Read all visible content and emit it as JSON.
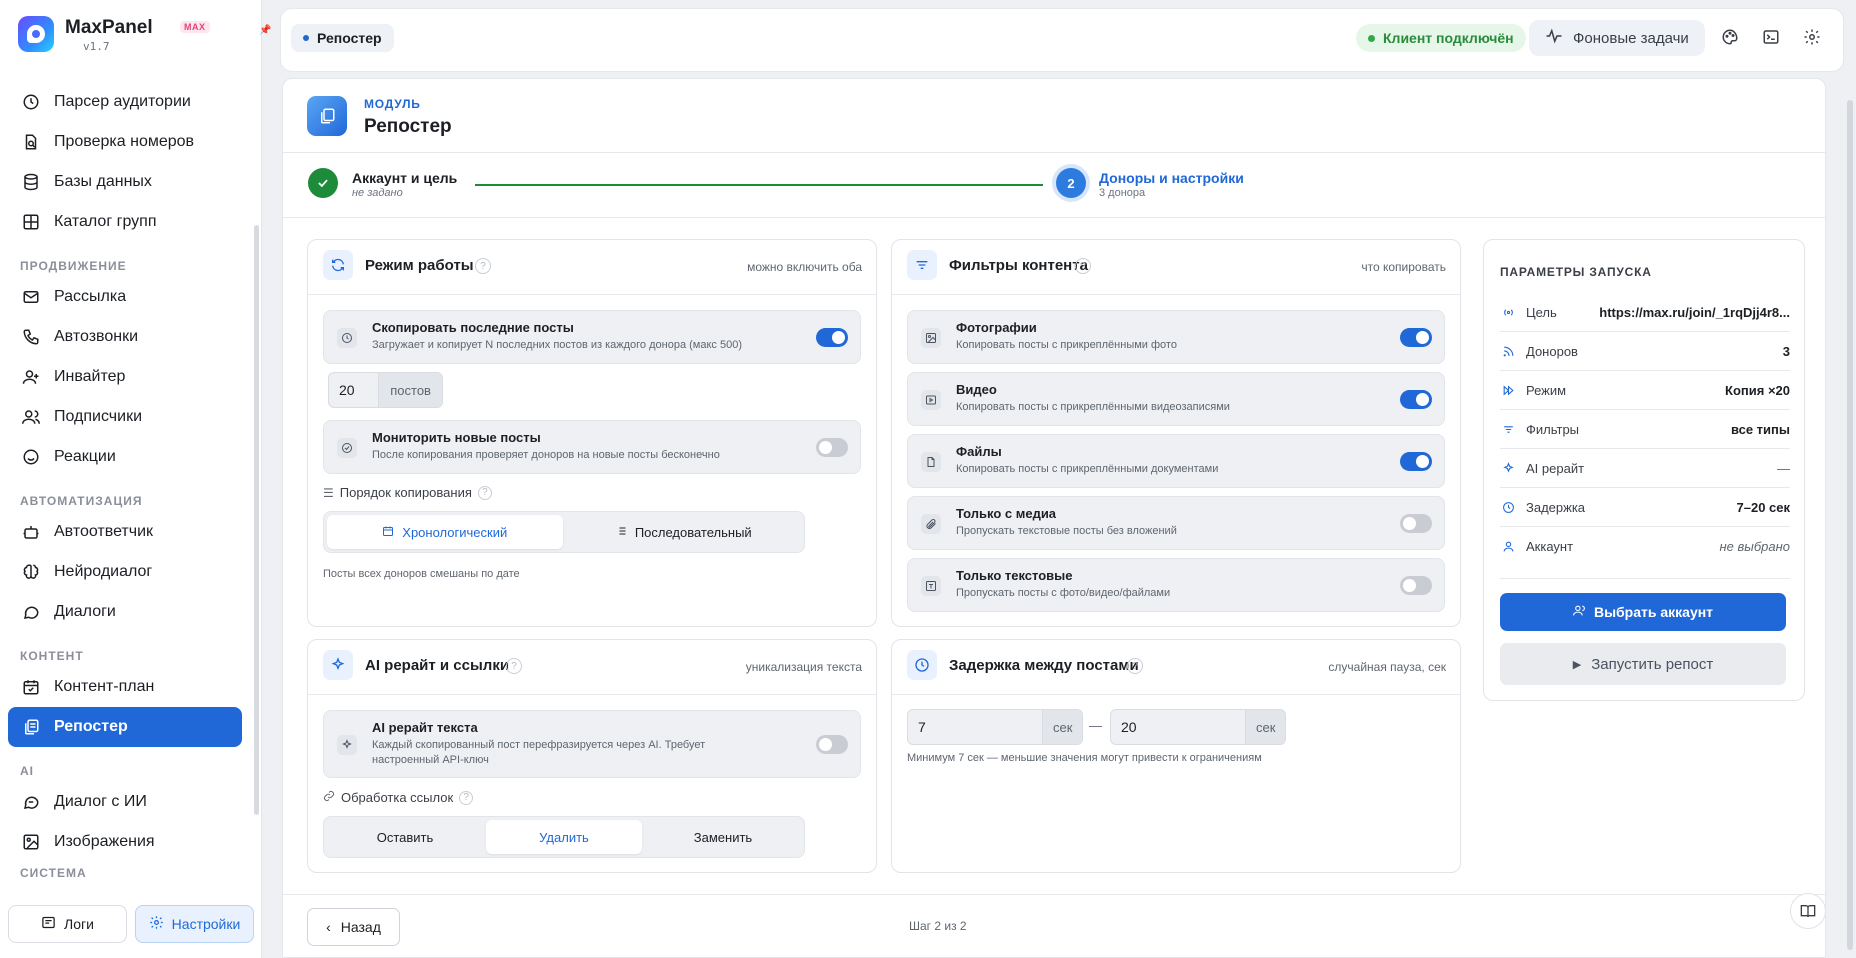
{
  "brand": {
    "name": "MaxPanel",
    "badge": "MAX",
    "version": "v1.7"
  },
  "sidebar": {
    "items_a": [
      {
        "label": "Парсер аудитории",
        "icon": "clock-icon"
      },
      {
        "label": "Проверка номеров",
        "icon": "search-doc-icon"
      },
      {
        "label": "Базы данных",
        "icon": "database-icon"
      },
      {
        "label": "Каталог групп",
        "icon": "grid-icon"
      }
    ],
    "sec_promo": "ПРОДВИЖЕНИЕ",
    "items_b": [
      {
        "label": "Рассылка",
        "icon": "mail-icon"
      },
      {
        "label": "Автозвонки",
        "icon": "phone-icon"
      },
      {
        "label": "Инвайтер",
        "icon": "user-plus-icon"
      },
      {
        "label": "Подписчики",
        "icon": "users-icon"
      },
      {
        "label": "Реакции",
        "icon": "smile-icon"
      }
    ],
    "sec_auto": "АВТОМАТИЗАЦИЯ",
    "items_c": [
      {
        "label": "Автоответчик",
        "icon": "bot-icon"
      },
      {
        "label": "Нейродиалог",
        "icon": "brain-icon"
      },
      {
        "label": "Диалоги",
        "icon": "chat-icon"
      }
    ],
    "sec_content": "КОНТЕНТ",
    "items_d": [
      {
        "label": "Контент-план",
        "icon": "calendar-icon"
      },
      {
        "label": "Репостер",
        "icon": "copy-icon",
        "active": true
      }
    ],
    "sec_ai": "AI",
    "items_e": [
      {
        "label": "Диалог с ИИ",
        "icon": "ai-chat-icon"
      },
      {
        "label": "Изображения",
        "icon": "image-icon"
      }
    ],
    "sec_sys": "СИСТЕМА",
    "logs_label": "Логи",
    "settings_label": "Настройки"
  },
  "topbar": {
    "crumb": "Репостер",
    "status": "Клиент подключён",
    "bg_tasks": "Фоновые задачи"
  },
  "module": {
    "label": "МОДУЛЬ",
    "title": "Репостер"
  },
  "steps": {
    "s1_title": "Аккаунт и цель",
    "s1_sub": "не задано",
    "s2_num": "2",
    "s2_title": "Доноры и настройки",
    "s2_sub": "3 донора"
  },
  "mode": {
    "title": "Режим работы",
    "hint": "можно включить оба",
    "copy_title": "Скопировать последние посты",
    "copy_sub": "Загружает и копирует N последних постов из каждого донора (макс 500)",
    "copy_on": true,
    "count": "20",
    "count_unit": "постов",
    "monitor_title": "Мониторить новые посты",
    "monitor_sub": "После копирования проверяет доноров на новые посты бесконечно",
    "monitor_on": false,
    "order_label": "Порядок копирования",
    "order_opt1": "Хронологический",
    "order_opt2": "Последовательный",
    "order_note": "Посты всех доноров смешаны по дате"
  },
  "filters": {
    "title": "Фильтры контента",
    "hint": "что копировать",
    "rows": [
      {
        "title": "Фотографии",
        "sub": "Копировать посты с прикреплёнными фото",
        "on": true
      },
      {
        "title": "Видео",
        "sub": "Копировать посты с прикреплёнными видеозаписями",
        "on": true
      },
      {
        "title": "Файлы",
        "sub": "Копировать посты с прикреплёнными документами",
        "on": true
      },
      {
        "title": "Только с медиа",
        "sub": "Пропускать текстовые посты без вложений",
        "on": false
      },
      {
        "title": "Только текстовые",
        "sub": "Пропускать посты с фото/видео/файлами",
        "on": false
      }
    ]
  },
  "ai": {
    "title": "AI рерайт и ссылки",
    "hint": "уникализация текста",
    "row_title": "AI рерайт текста",
    "row_sub": "Каждый скопированный пост перефразируется через AI. Требует настроенный API-ключ",
    "links_label": "Обработка ссылок",
    "opt1": "Оставить",
    "opt2": "Удалить",
    "opt3": "Заменить"
  },
  "delay": {
    "title": "Задержка между постами",
    "hint": "случайная пауза, сек",
    "min": "7",
    "max": "20",
    "unit": "сек",
    "dash": "—",
    "note": "Минимум 7 сек — меньшие значения могут привести к ограничениям"
  },
  "params": {
    "title": "ПАРАМЕТРЫ ЗАПУСКА",
    "rows": [
      {
        "label": "Цель",
        "value": "https://max.ru/join/_1rqDjj4r8..."
      },
      {
        "label": "Доноров",
        "value": "3"
      },
      {
        "label": "Режим",
        "value": "Копия ×20"
      },
      {
        "label": "Фильтры",
        "value": "все типы"
      },
      {
        "label": "AI рерайт",
        "value": "—"
      },
      {
        "label": "Задержка",
        "value": "7–20 сек"
      },
      {
        "label": "Аккаунт",
        "value": "не выбрано"
      }
    ],
    "btn_account": "Выбрать аккаунт",
    "btn_start": "Запустить репост"
  },
  "footer": {
    "back": "Назад",
    "step": "Шаг 2 из 2"
  },
  "colors": {
    "accent": "#2068d8",
    "success": "#1d8b3a"
  }
}
